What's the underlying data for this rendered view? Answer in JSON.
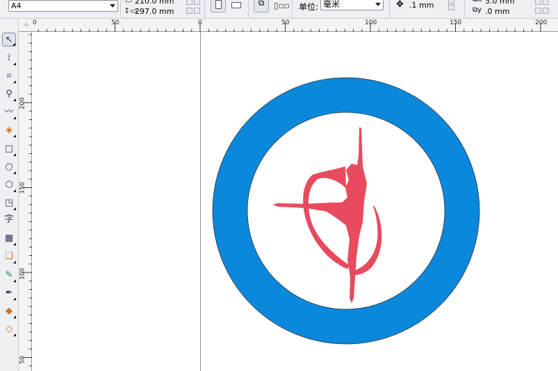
{
  "property_bar": {
    "paper_size": "A4",
    "width": "210.0 mm",
    "height": "297.0 mm",
    "units_label": "单位:",
    "units_value": "毫米",
    "nudge": ".1 mm",
    "dup_x": "5.0 mm",
    "dup_y": ".0 mm"
  },
  "ruler_top": [
    "0",
    "50",
    "0",
    "50",
    "100",
    "150",
    "200"
  ],
  "ruler_left": [
    "200",
    "150",
    "100",
    "50"
  ],
  "toolbox": [
    {
      "icon": "pick-tool-icon"
    },
    {
      "icon": "shape-tool-icon"
    },
    {
      "icon": "crop-tool-icon"
    },
    {
      "icon": "zoom-tool-icon"
    },
    {
      "icon": "freehand-tool-icon"
    },
    {
      "icon": "smart-fill-icon"
    },
    {
      "icon": "rectangle-tool-icon"
    },
    {
      "icon": "ellipse-tool-icon"
    },
    {
      "icon": "polygon-tool-icon"
    },
    {
      "icon": "basic-shapes-icon"
    },
    {
      "icon": "text-tool-icon",
      "label": "字"
    },
    {
      "icon": "table-tool-icon"
    },
    {
      "icon": "interactive-tools-icon"
    },
    {
      "icon": "eyedropper-icon"
    },
    {
      "icon": "outline-pen-icon"
    },
    {
      "icon": "fill-tool-icon"
    },
    {
      "icon": "interactive-fill-icon"
    }
  ],
  "colors": {
    "ring": "#0a88dc",
    "dancer": "#e94a5e"
  }
}
